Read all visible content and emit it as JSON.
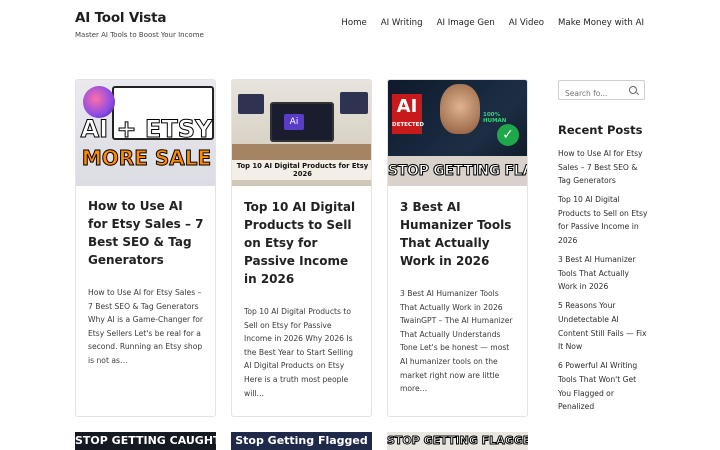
{
  "site": {
    "title": "AI Tool Vista",
    "tagline": "Master AI Tools to Boost Your Income"
  },
  "nav": [
    "Home",
    "AI Writing",
    "AI Image Gen",
    "AI Video",
    "Make Money with AI"
  ],
  "posts": [
    {
      "thumb_text": [
        "AI + ETSY",
        "MORE SALE"
      ],
      "title": "How to Use AI for Etsy Sales – 7 Best SEO & Tag Generators",
      "excerpt": "How to Use AI for Etsy Sales – 7 Best SEO & Tag Generators Why AI is a Game-Changer for Etsy Sellers Let's be real for a second. Running an Etsy shop is not as…"
    },
    {
      "thumb_text": [
        "Ai",
        "Top 10 AI Digital Products for Etsy 2026"
      ],
      "title": "Top 10 AI Digital Products to Sell on Etsy for Passive Income in 2026",
      "excerpt": "Top 10 AI Digital Products to Sell on Etsy for Passive Income in 2026 Why 2026 Is the Best Year to Start Selling AI Digital Products on Etsy Here is a truth most people will…"
    },
    {
      "thumb_text": [
        "AI",
        "DETECTED",
        "100% HUMAN",
        "STOP GETTING FLAGGED"
      ],
      "title": "3 Best AI Humanizer Tools That Actually Work in 2026",
      "excerpt": "3 Best AI Humanizer Tools That Actually Work in 2026 TwainGPT – The AI Humanizer That Actually Understands Tone Let's be honest — most AI humanizer tools on the market right now are little more…"
    }
  ],
  "more_thumbs": [
    "STOP GETTING CAUGHT",
    "Stop Getting Flagged",
    "STOP GETTING FLAGGED"
  ],
  "sidebar": {
    "search_placeholder": "Search fo...",
    "recent_title": "Recent Posts",
    "recent_posts": [
      "How to Use AI for Etsy Sales – 7 Best SEO & Tag Generators",
      "Top 10 AI Digital Products to Sell on Etsy for Passive Income in 2026",
      "3 Best AI Humanizer Tools That Actually Work in 2026",
      "5 Reasons Your Undetectable AI Content Still Fails — Fix It Now",
      "6 Powerful AI Writing Tools That Won't Get You Flagged or Penalized"
    ]
  }
}
